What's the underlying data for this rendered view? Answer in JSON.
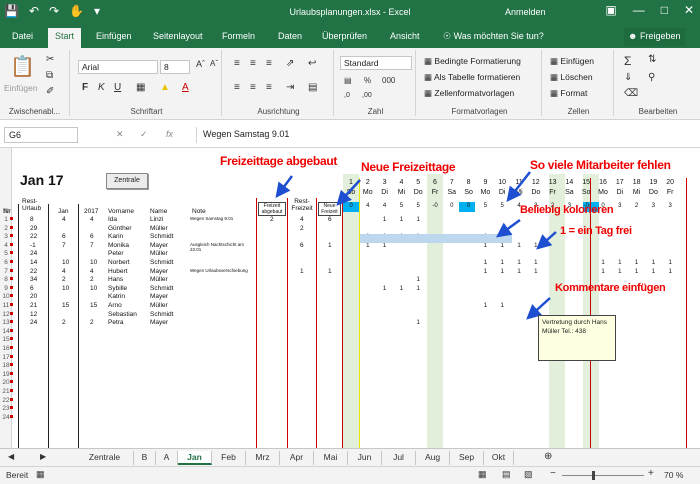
{
  "window": {
    "title": "Urlaubsplanungen.xlsx  -  Excel",
    "signin": "Anmelden"
  },
  "tabs": [
    "Datei",
    "Start",
    "Einfügen",
    "Seitenlayout",
    "Formeln",
    "Daten",
    "Überprüfen",
    "Ansicht"
  ],
  "tellme": "Was möchten Sie tun?",
  "share": "Freigeben",
  "ribbon": {
    "clipboard_label": "Zwischenabl...",
    "paste_label": "Einfügen",
    "font_label": "Schriftart",
    "font_name": "Arial",
    "font_size": "8",
    "alignment_label": "Ausrichtung",
    "number_format": "Standard",
    "number_label": "Zahl",
    "cond_format": "Bedingte Formatierung",
    "as_table": "Als Tabelle formatieren",
    "cell_styles": "Zellenformatvorlagen",
    "styles_label": "Formatvorlagen",
    "insert": "Einfügen",
    "delete": "Löschen",
    "format": "Format",
    "cells_label": "Zellen",
    "edit_label": "Bearbeiten"
  },
  "formula_bar": {
    "name_box": "G6",
    "formula": "Wegen Samstag 9.01"
  },
  "sheet": {
    "month_title": "Jan 17",
    "zentrale_button": "Zentrale",
    "headers": {
      "nr": "Nr",
      "rest_urlaub": "Rest-Urlaub",
      "jan": "Jan",
      "year": "2017",
      "vorname": "Vorname",
      "name": "Name",
      "note": "Note",
      "freizeit_abgebaut": "Freizeit abgebaut",
      "rest_freizeit": "Rest-Freizeit",
      "neue_freizeit": "Neue Freizeit"
    },
    "days": [
      "1",
      "2",
      "3",
      "4",
      "5",
      "6",
      "7",
      "8",
      "9",
      "10",
      "11",
      "12",
      "13",
      "14",
      "15",
      "16",
      "17",
      "18",
      "19",
      "20"
    ],
    "weekdays": [
      "So",
      "Mo",
      "Di",
      "Mi",
      "Do",
      "Fr",
      "Sa",
      "So",
      "Mo",
      "Di",
      "Mi",
      "Do",
      "Fr",
      "Sa",
      "So",
      "Mo",
      "Di",
      "Mi",
      "Do",
      "Fr"
    ],
    "rows": [
      {
        "nr": "1",
        "rest": "8",
        "jan": "4",
        "y": "4",
        "vor": "Ida",
        "name": "Linzi",
        "note": "Wegen Samstag 9.01",
        "fa": "2",
        "rf": "4",
        "nf": "6"
      },
      {
        "nr": "2",
        "rest": "29",
        "jan": "",
        "y": "",
        "vor": "Günther",
        "name": "Müller",
        "note": "",
        "fa": "",
        "rf": "2",
        "nf": ""
      },
      {
        "nr": "3",
        "rest": "22",
        "jan": "6",
        "y": "6",
        "vor": "Karin",
        "name": "Schmidt",
        "note": "",
        "fa": "",
        "rf": "",
        "nf": ""
      },
      {
        "nr": "4",
        "rest": "-1",
        "jan": "7",
        "y": "7",
        "vor": "Monika",
        "name": "Mayer",
        "note": "Ausgleich Nachtschicht am 22.01",
        "fa": "",
        "rf": "6",
        "nf": "1"
      },
      {
        "nr": "5",
        "rest": "24",
        "jan": "",
        "y": "",
        "vor": "Peter",
        "name": "Müller",
        "note": "",
        "fa": "",
        "rf": "",
        "nf": ""
      },
      {
        "nr": "6",
        "rest": "14",
        "jan": "10",
        "y": "10",
        "vor": "Norbert",
        "name": "Schmidt",
        "note": "",
        "fa": "",
        "rf": "",
        "nf": ""
      },
      {
        "nr": "7",
        "rest": "22",
        "jan": "4",
        "y": "4",
        "vor": "Hubert",
        "name": "Mayer",
        "note": "Wegen Urlaubsverschiebung",
        "fa": "",
        "rf": "1",
        "nf": "1"
      },
      {
        "nr": "8",
        "rest": "34",
        "jan": "2",
        "y": "2",
        "vor": "Hans",
        "name": "Müller",
        "note": "",
        "fa": "",
        "rf": "",
        "nf": ""
      },
      {
        "nr": "9",
        "rest": "6",
        "jan": "10",
        "y": "10",
        "vor": "Sybille",
        "name": "Schmidt",
        "note": "",
        "fa": "",
        "rf": "",
        "nf": ""
      },
      {
        "nr": "10",
        "rest": "20",
        "jan": "",
        "y": "",
        "vor": "Katrin",
        "name": "Mayer",
        "note": "",
        "fa": "",
        "rf": "",
        "nf": ""
      },
      {
        "nr": "11",
        "rest": "21",
        "jan": "15",
        "y": "15",
        "vor": "Arno",
        "name": "Müller",
        "note": "",
        "fa": "",
        "rf": "",
        "nf": ""
      },
      {
        "nr": "12",
        "rest": "12",
        "jan": "",
        "y": "",
        "vor": "Sebastian",
        "name": "Schmidt",
        "note": "",
        "fa": "",
        "rf": "",
        "nf": ""
      },
      {
        "nr": "13",
        "rest": "24",
        "jan": "2",
        "y": "2",
        "vor": "Petra",
        "name": "Mayer",
        "note": "",
        "fa": "",
        "rf": "",
        "nf": ""
      }
    ],
    "missing_counts": [
      "0",
      "4",
      "4",
      "5",
      "5",
      "-0",
      "0",
      "0",
      "5",
      "5",
      "4",
      "3",
      "2",
      "3",
      "-0",
      "0",
      "3",
      "2",
      "3",
      "3"
    ],
    "annotations": {
      "freizeit_abgebaut": "Freizeittage abgebaut",
      "neue_freizeittage": "Neue Freizeittage",
      "mitarbeiter_fehlen": "So viele Mitarbeiter fehlen",
      "kolorieren": "Beliebig kolorieren",
      "tag_frei": "1 = ein Tag frei",
      "kommentare": "Kommentare einfügen"
    },
    "comment": "Vertretung durch Hans Müller Tel.: 438",
    "extra_row_numbers": [
      "14",
      "15",
      "16",
      "17",
      "18",
      "19",
      "20",
      "21",
      "22",
      "23",
      "24"
    ]
  },
  "sheet_tabs": [
    "Zentrale",
    "B",
    "A",
    "Jan",
    "Feb",
    "Mrz",
    "Apr",
    "Mai",
    "Jun",
    "Jul",
    "Aug",
    "Sep",
    "Okt"
  ],
  "status": {
    "ready": "Bereit",
    "zoom": "70 %"
  },
  "colors": {
    "excel_green": "#217346",
    "annotation_red": "#e00000",
    "arrow_blue": "#1f4fd1",
    "weekend_green": "#e2efda",
    "highlight_blue": "#bdd7ee",
    "cyan": "#00b0f0"
  }
}
